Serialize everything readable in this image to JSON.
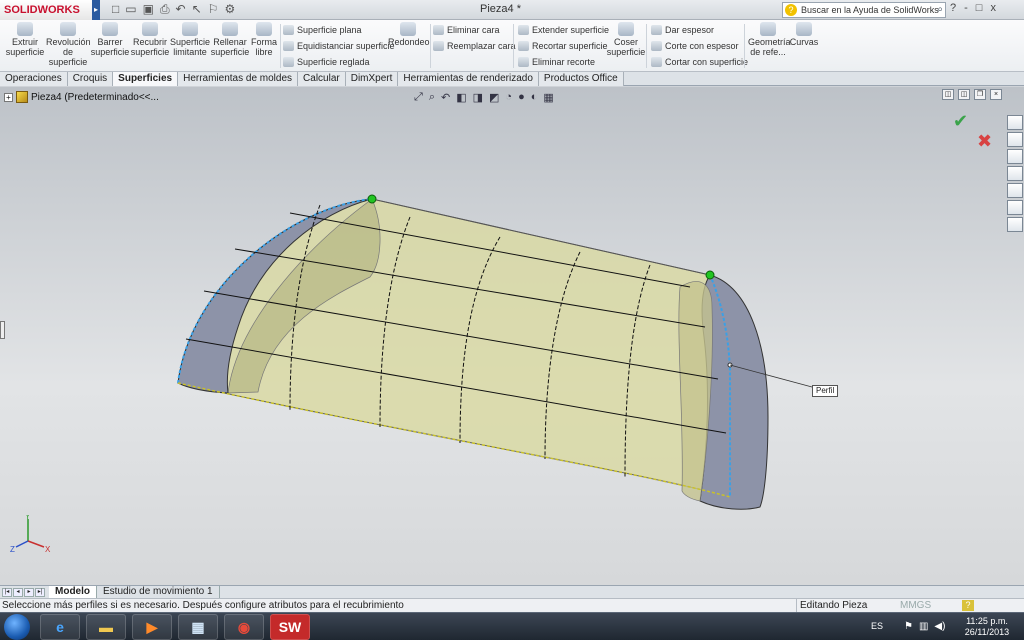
{
  "app": {
    "brand": "SOLIDWORKS",
    "document_title": "Pieza4 *",
    "help_search_placeholder": "Buscar en la Ayuda de SolidWorks",
    "window_controls": [
      "?",
      "-",
      "□",
      "x"
    ]
  },
  "ribbon": {
    "large_buttons": [
      {
        "label": "Extruir superficie",
        "icon": "extrude-surface-icon"
      },
      {
        "label": "Revolución de superficie",
        "icon": "revolve-surface-icon"
      },
      {
        "label": "Barrer superficie",
        "icon": "sweep-surface-icon"
      },
      {
        "label": "Recubrir superficie",
        "icon": "loft-surface-icon"
      },
      {
        "label": "Superficie limitante",
        "icon": "boundary-surface-icon"
      },
      {
        "label": "Rellenar superficie",
        "icon": "fill-surface-icon"
      },
      {
        "label": "Forma libre",
        "icon": "freeform-icon"
      }
    ],
    "group1": [
      "Superficie plana",
      "Equidistanciar superficie",
      "Superficie reglada"
    ],
    "redondeo": "Redondeo",
    "group2": [
      "Eliminar cara",
      "Reemplazar cara"
    ],
    "group3": [
      "Extender superficie",
      "Recortar superficie",
      "Eliminar recorte"
    ],
    "coser": "Coser superficie",
    "group4": [
      "Dar espesor",
      "Corte con espesor",
      "Cortar con superficie"
    ],
    "geometria": "Geometría de refe...",
    "curvas": "Curvas"
  },
  "tabs": [
    "Operaciones",
    "Croquis",
    "Superficies",
    "Herramientas de moldes",
    "Calcular",
    "DimXpert",
    "Herramientas de renderizado",
    "Productos Office"
  ],
  "active_tab": "Superficies",
  "tree": {
    "label": "Pieza4  (Predeterminado<<..."
  },
  "callout": {
    "label": "Perfil"
  },
  "triad": {
    "x": "X",
    "y": "Y",
    "z": "Z"
  },
  "bottom_tabs": [
    "Modelo",
    "Estudio de movimiento 1"
  ],
  "status": {
    "message": "Seleccione más perfiles si es necesario. Después configure atributos para el recubrimiento",
    "mode": "Editando Pieza",
    "units": "MMGS",
    "help": "?"
  },
  "taskbar": {
    "language": "ES",
    "time": "11:25 p.m.",
    "date": "26/11/2013"
  },
  "colors": {
    "surface_fill": "#d9d9a4",
    "surface_edge": "#1a1a1a",
    "profile_highlight": "#3aa0e6",
    "endpoint": "#22c422",
    "end_cap": "#8d93a8"
  }
}
